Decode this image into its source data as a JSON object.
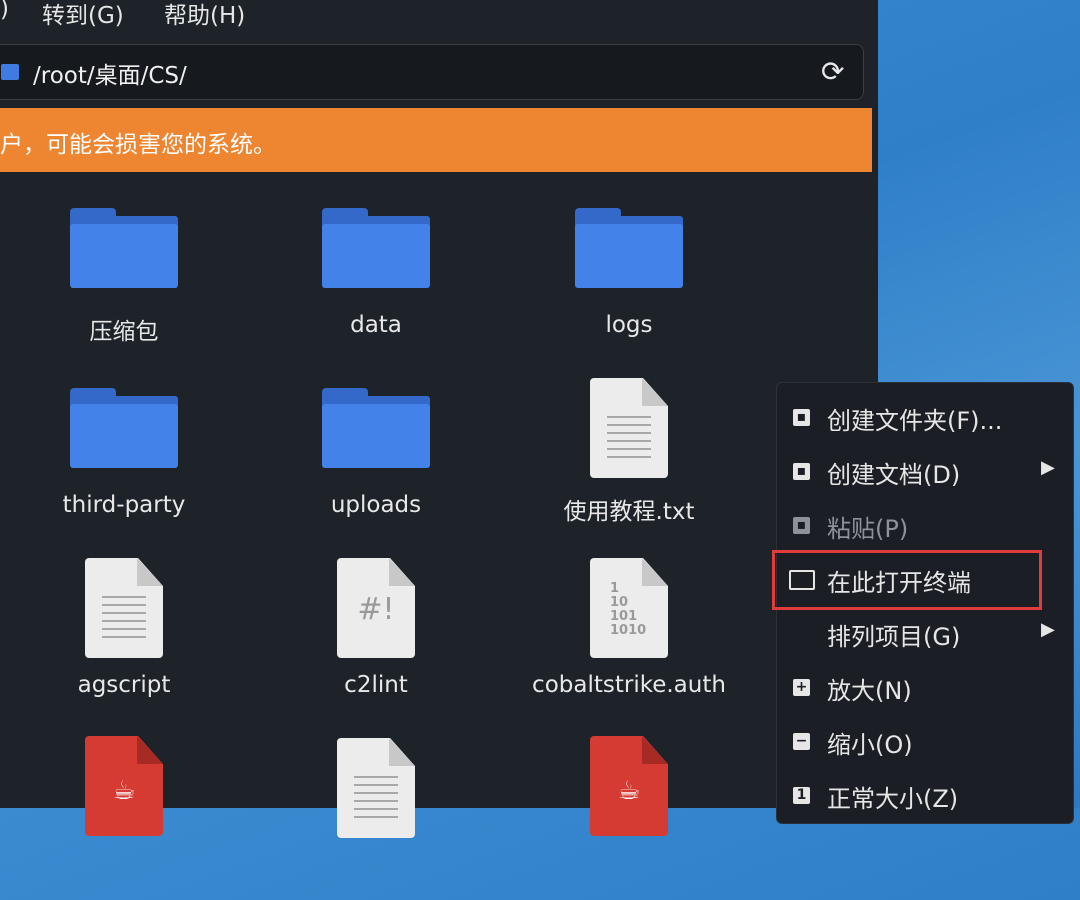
{
  "menubar": {
    "partial_item": ")",
    "goto": "转到(G)",
    "help": "帮助(H)"
  },
  "path": {
    "value": "/root/桌面/CS/",
    "reload_icon": "reload-icon"
  },
  "warning": {
    "text": "户，可能会损害您的系统。"
  },
  "files": [
    {
      "name": "压缩包",
      "type": "folder"
    },
    {
      "name": "data",
      "type": "folder"
    },
    {
      "name": "logs",
      "type": "folder"
    },
    {
      "name": "third-party",
      "type": "folder"
    },
    {
      "name": "uploads",
      "type": "folder"
    },
    {
      "name": "使用教程.txt",
      "type": "text"
    },
    {
      "name": "agscript",
      "type": "text"
    },
    {
      "name": "c2lint",
      "type": "script"
    },
    {
      "name": "cobaltstrike.auth",
      "type": "binary"
    },
    {
      "name": "",
      "type": "java"
    },
    {
      "name": "",
      "type": "text"
    },
    {
      "name": "",
      "type": "java"
    }
  ],
  "glyphs": {
    "script": "#!",
    "binary": "1\n10\n101\n1010"
  },
  "context_menu": {
    "items": [
      {
        "label": "创建文件夹(F)...",
        "icon": "new-folder-icon",
        "submenu": false,
        "disabled": false
      },
      {
        "label": "创建文档(D)",
        "icon": "new-document-icon",
        "submenu": true,
        "disabled": false
      },
      {
        "label": "粘贴(P)",
        "icon": "paste-icon",
        "submenu": false,
        "disabled": true
      },
      {
        "label": "在此打开终端",
        "icon": "terminal-icon",
        "submenu": false,
        "disabled": false
      },
      {
        "label": "排列项目(G)",
        "icon": "",
        "submenu": true,
        "disabled": false
      },
      {
        "label": "放大(N)",
        "icon": "zoom-in-icon",
        "submenu": false,
        "disabled": false
      },
      {
        "label": "缩小(O)",
        "icon": "zoom-out-icon",
        "submenu": false,
        "disabled": false
      },
      {
        "label": "正常大小(Z)",
        "icon": "normal-size-icon",
        "submenu": false,
        "disabled": false
      }
    ],
    "highlight_color": "#e03c3c"
  },
  "colors": {
    "folder": "#4382e8",
    "warning": "#ee8530",
    "java_file": "#d53b33"
  }
}
